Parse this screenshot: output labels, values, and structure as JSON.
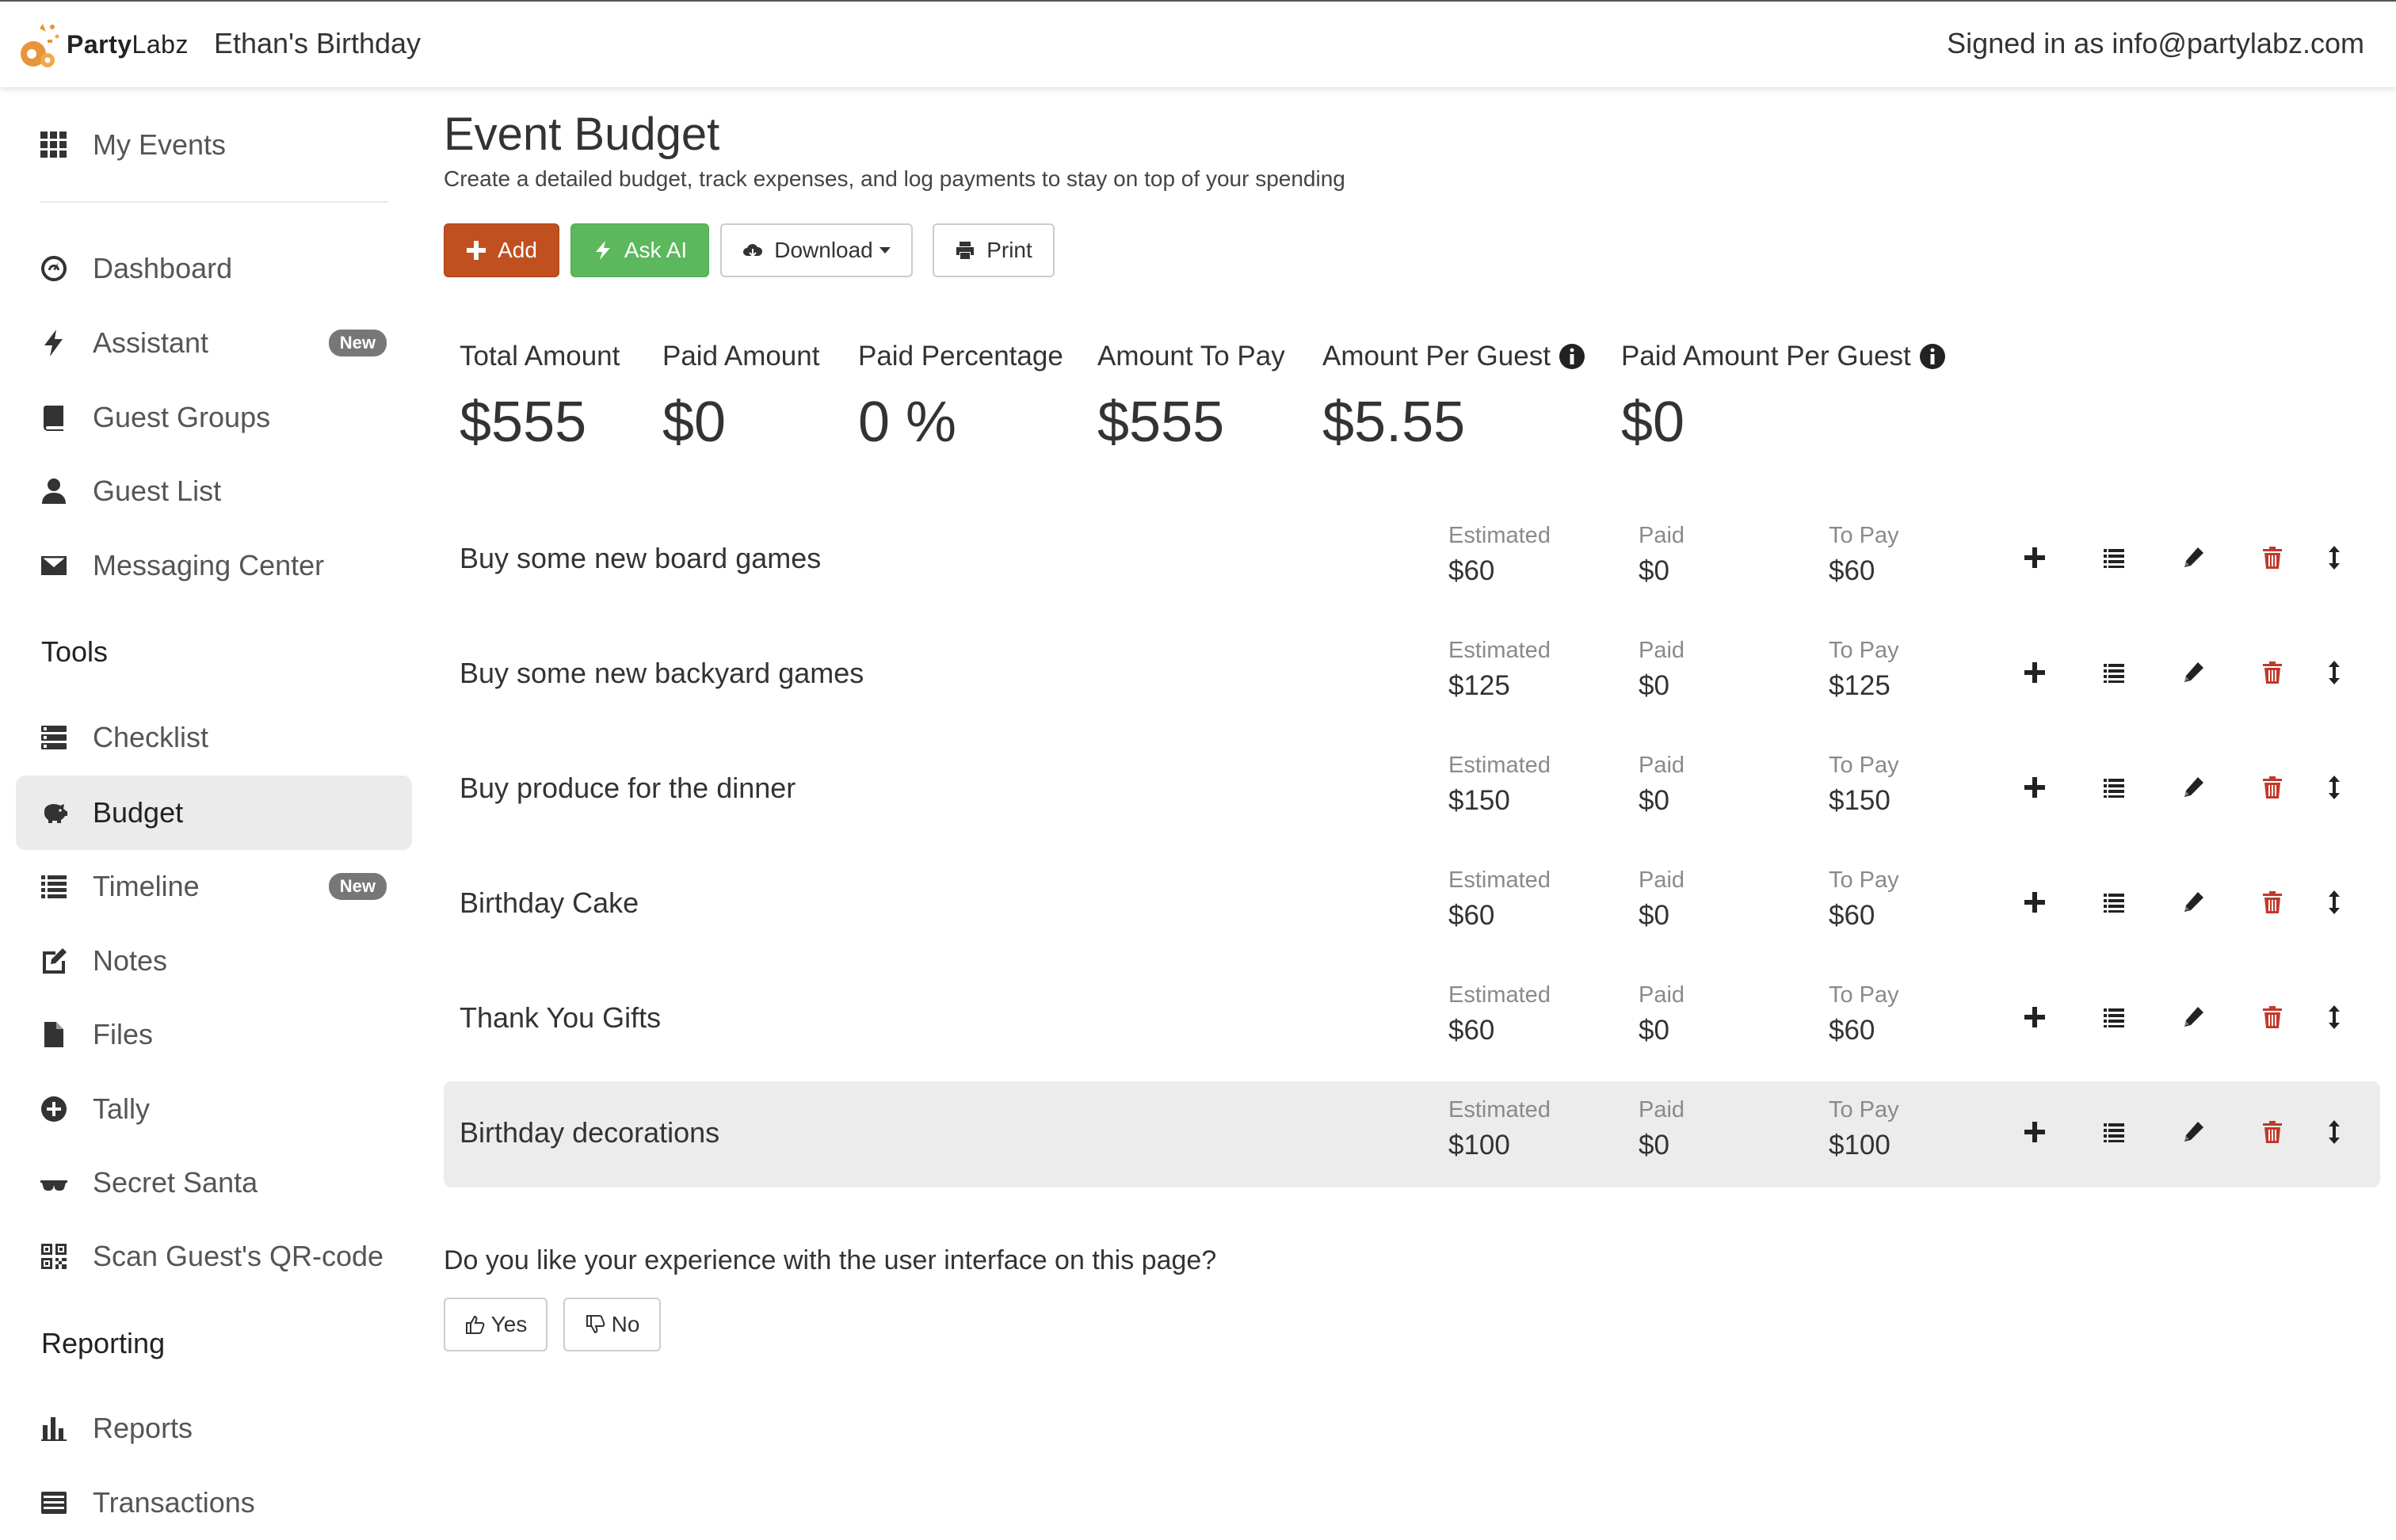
{
  "header": {
    "brand_prefix": "Party",
    "brand_suffix": "Labz",
    "event_name": "Ethan's Birthday",
    "signed_in": "Signed in as info@partylabz.com"
  },
  "sidebar": {
    "my_events": "My Events",
    "items": [
      {
        "label": "Dashboard",
        "icon": "dashboard-icon"
      },
      {
        "label": "Assistant",
        "icon": "bolt-icon",
        "badge": "New"
      },
      {
        "label": "Guest Groups",
        "icon": "book-icon"
      },
      {
        "label": "Guest List",
        "icon": "user-icon"
      },
      {
        "label": "Messaging Center",
        "icon": "envelope-icon"
      }
    ],
    "tools_heading": "Tools",
    "tools": [
      {
        "label": "Checklist",
        "icon": "checklist-icon"
      },
      {
        "label": "Budget",
        "icon": "piggy-bank-icon",
        "active": true
      },
      {
        "label": "Timeline",
        "icon": "list-icon",
        "badge": "New"
      },
      {
        "label": "Notes",
        "icon": "edit-icon"
      },
      {
        "label": "Files",
        "icon": "file-icon"
      },
      {
        "label": "Tally",
        "icon": "plus-circle-icon"
      },
      {
        "label": "Secret Santa",
        "icon": "glasses-icon"
      },
      {
        "label": "Scan Guest's QR-code",
        "icon": "qrcode-icon"
      }
    ],
    "reporting_heading": "Reporting",
    "reporting": [
      {
        "label": "Reports",
        "icon": "bar-chart-icon"
      },
      {
        "label": "Transactions",
        "icon": "list-icon"
      }
    ]
  },
  "main": {
    "title": "Event Budget",
    "subtitle": "Create a detailed budget, track expenses, and log payments to stay on top of your spending",
    "buttons": {
      "add": "Add",
      "ask_ai": "Ask AI",
      "download": "Download",
      "print": "Print"
    },
    "stats": [
      {
        "label": "Total Amount",
        "value": "$555"
      },
      {
        "label": "Paid Amount",
        "value": "$0"
      },
      {
        "label": "Paid Percentage",
        "value": "0 %"
      },
      {
        "label": "Amount To Pay",
        "value": "$555"
      },
      {
        "label": "Amount Per Guest",
        "value": "$5.55",
        "info": true
      },
      {
        "label": "Paid Amount Per Guest",
        "value": "$0",
        "info": true
      }
    ],
    "column_labels": {
      "estimated": "Estimated",
      "paid": "Paid",
      "to_pay": "To Pay"
    },
    "items": [
      {
        "name": "Buy some new board games",
        "estimated": "$60",
        "paid": "$0",
        "to_pay": "$60"
      },
      {
        "name": "Buy some new backyard games",
        "estimated": "$125",
        "paid": "$0",
        "to_pay": "$125"
      },
      {
        "name": "Buy produce for the dinner",
        "estimated": "$150",
        "paid": "$0",
        "to_pay": "$150"
      },
      {
        "name": "Birthday Cake",
        "estimated": "$60",
        "paid": "$0",
        "to_pay": "$60"
      },
      {
        "name": "Thank You Gifts",
        "estimated": "$60",
        "paid": "$0",
        "to_pay": "$60"
      },
      {
        "name": "Birthday decorations",
        "estimated": "$100",
        "paid": "$0",
        "to_pay": "$100",
        "highlighted": true
      }
    ],
    "feedback": {
      "question": "Do you like your experience with the user interface on this page?",
      "yes": "Yes",
      "no": "No"
    }
  },
  "colors": {
    "add_button": "#c0501f",
    "ai_button": "#5cb85c",
    "delete_icon": "#c0392b",
    "active_nav_bg": "#ebebeb"
  }
}
